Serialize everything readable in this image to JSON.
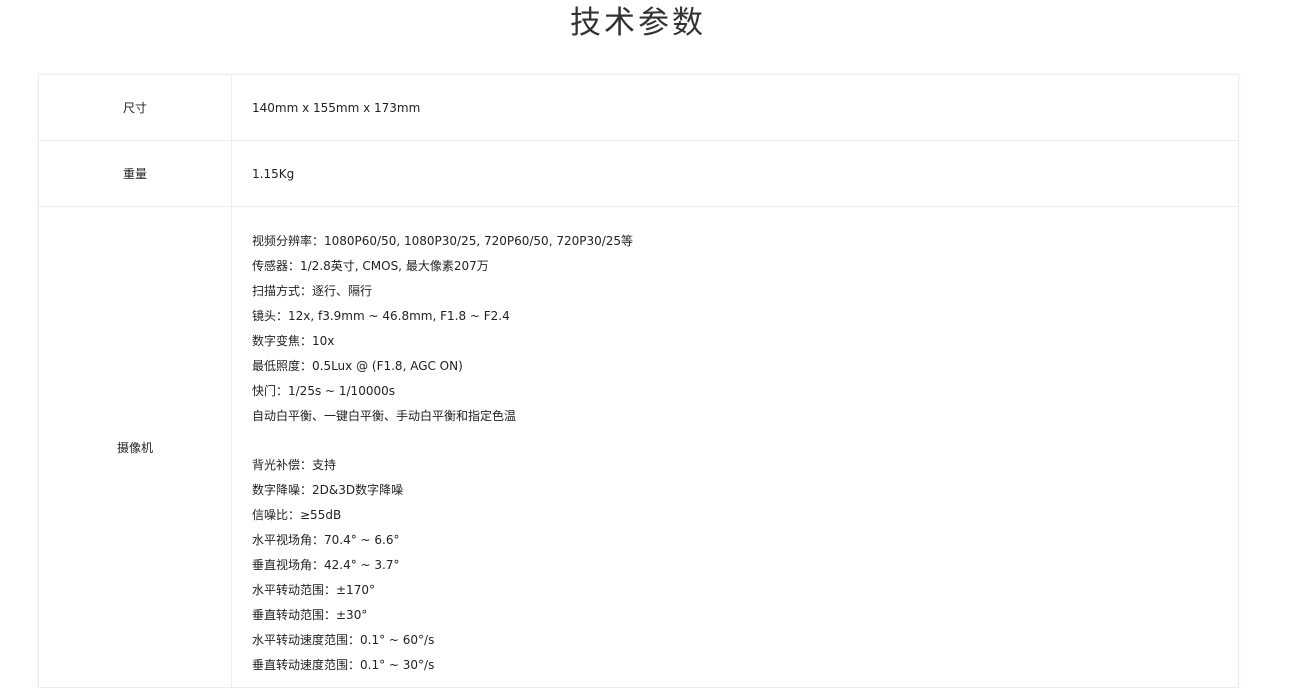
{
  "page": {
    "title": "技术参数"
  },
  "specs": {
    "size": {
      "label": "尺寸",
      "value": "140mm x 155mm x 173mm"
    },
    "weight": {
      "label": "重量",
      "value": "1.15Kg"
    },
    "camera": {
      "label": "摄像机",
      "lines_a": [
        "视频分辨率：1080P60/50, 1080P30/25, 720P60/50, 720P30/25等",
        "传感器：1/2.8英寸, CMOS, 最大像素207万",
        "扫描方式：逐行、隔行",
        "镜头：12x, f3.9mm ~ 46.8mm, F1.8 ~ F2.4",
        "数字变焦：10x",
        "最低照度：0.5Lux @ (F1.8, AGC ON)",
        "快门：1/25s ~ 1/10000s",
        "自动白平衡、一键白平衡、手动白平衡和指定色温"
      ],
      "lines_b": [
        "背光补偿：支持",
        "数字降噪：2D&3D数字降噪",
        "信噪比：≥55dB",
        "水平视场角：70.4° ~ 6.6°",
        "垂直视场角：42.4° ~ 3.7°",
        "水平转动范围：±170°",
        "垂直转动范围：±30°",
        "水平转动速度范围：0.1° ~ 60°/s",
        "垂直转动速度范围：0.1° ~ 30°/s"
      ]
    }
  }
}
